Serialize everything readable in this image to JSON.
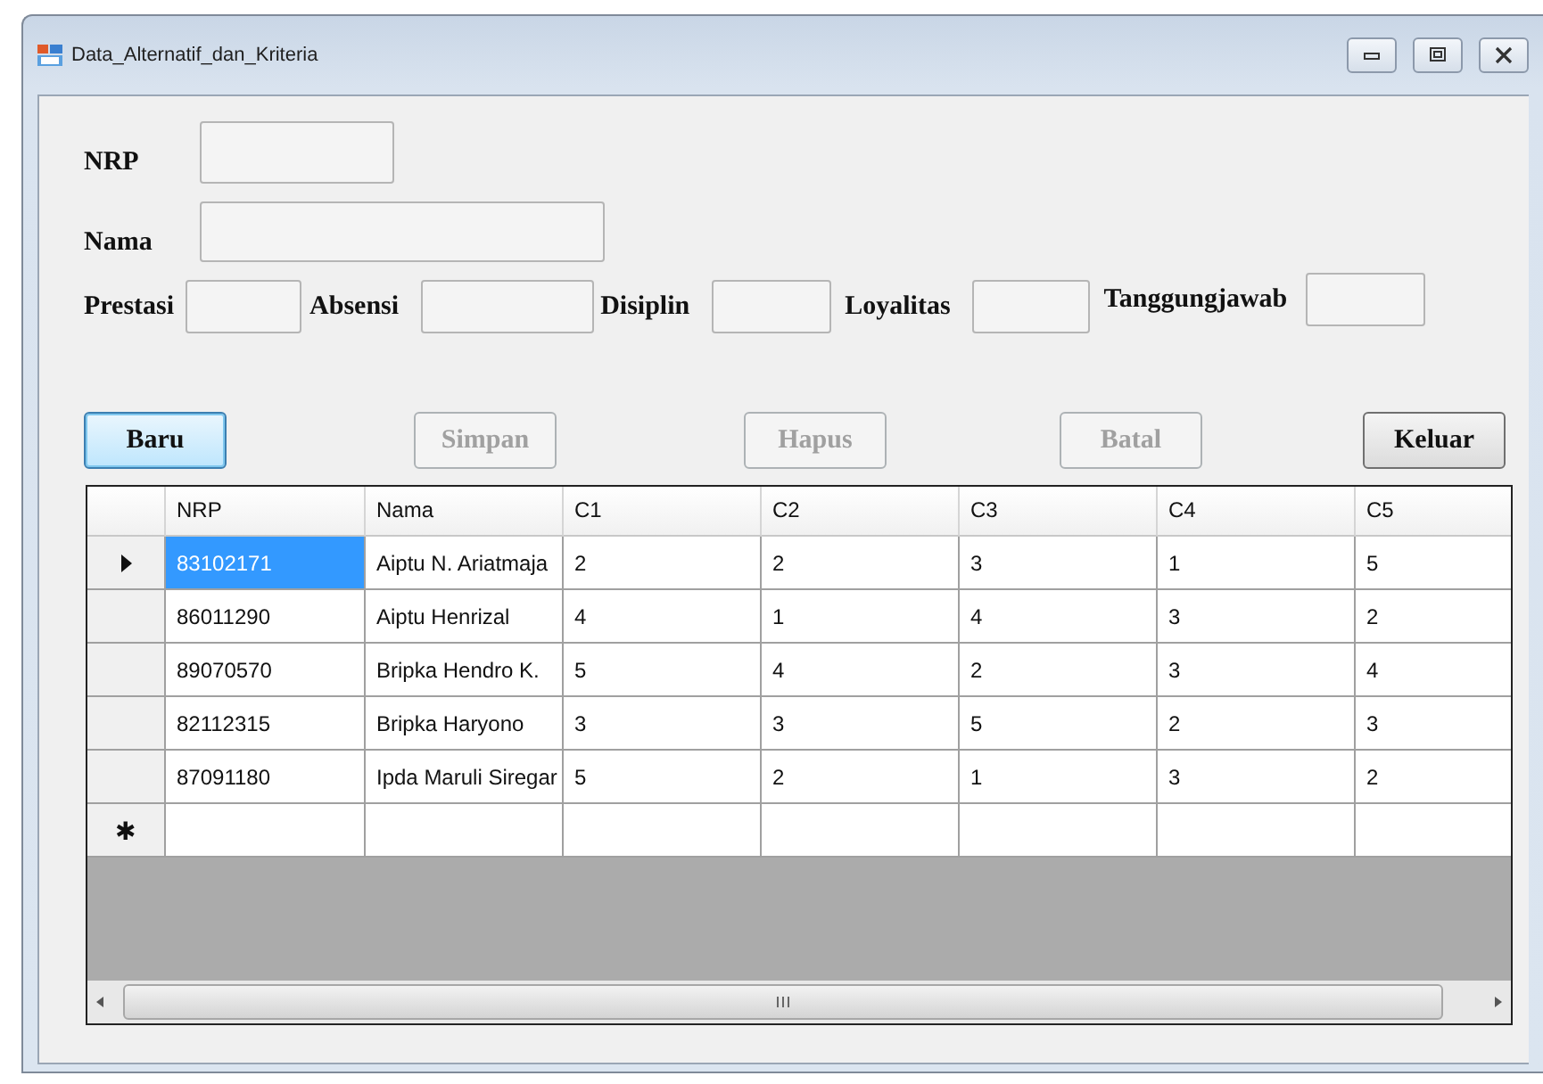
{
  "window": {
    "title": "Data_Alternatif_dan_Kriteria"
  },
  "fields": [
    {
      "label": "NRP",
      "kind": "short"
    },
    {
      "label": "Nama",
      "kind": "long"
    },
    {
      "label": "Prestasi",
      "kind": "inline"
    },
    {
      "label": "Absensi",
      "kind": "inline"
    },
    {
      "label": "Disiplin",
      "kind": "inline"
    },
    {
      "label": "Loyalitas",
      "kind": "inline"
    },
    {
      "label": "Tanggungjawab",
      "kind": "inline"
    }
  ],
  "buttons": [
    {
      "label": "Baru",
      "disabled": false,
      "focused": true
    },
    {
      "label": "Simpan",
      "disabled": true,
      "focused": false
    },
    {
      "label": "Hapus",
      "disabled": true,
      "focused": false
    },
    {
      "label": "Batal",
      "disabled": true,
      "focused": false
    },
    {
      "label": "Keluar",
      "disabled": false,
      "focused": false
    }
  ],
  "table": {
    "columns": [
      "NRP",
      "Nama",
      "C1",
      "C2",
      "C3",
      "C4",
      "C5"
    ],
    "rows": [
      {
        "selected": true,
        "cells": [
          "83102171",
          "Aiptu N. Ariatmaja",
          "2",
          "2",
          "3",
          "1",
          "5"
        ]
      },
      {
        "selected": false,
        "cells": [
          "86011290",
          "Aiptu Henrizal",
          "4",
          "1",
          "4",
          "3",
          "2"
        ]
      },
      {
        "selected": false,
        "cells": [
          "89070570",
          "Bripka Hendro K.",
          "5",
          "4",
          "2",
          "3",
          "4"
        ]
      },
      {
        "selected": false,
        "cells": [
          "82112315",
          "Bripka Haryono",
          "3",
          "3",
          "5",
          "2",
          "3"
        ]
      },
      {
        "selected": false,
        "cells": [
          "87091180",
          "Ipda Maruli Siregar",
          "5",
          "2",
          "1",
          "3",
          "2"
        ]
      }
    ],
    "new_row_marker": "✱"
  }
}
